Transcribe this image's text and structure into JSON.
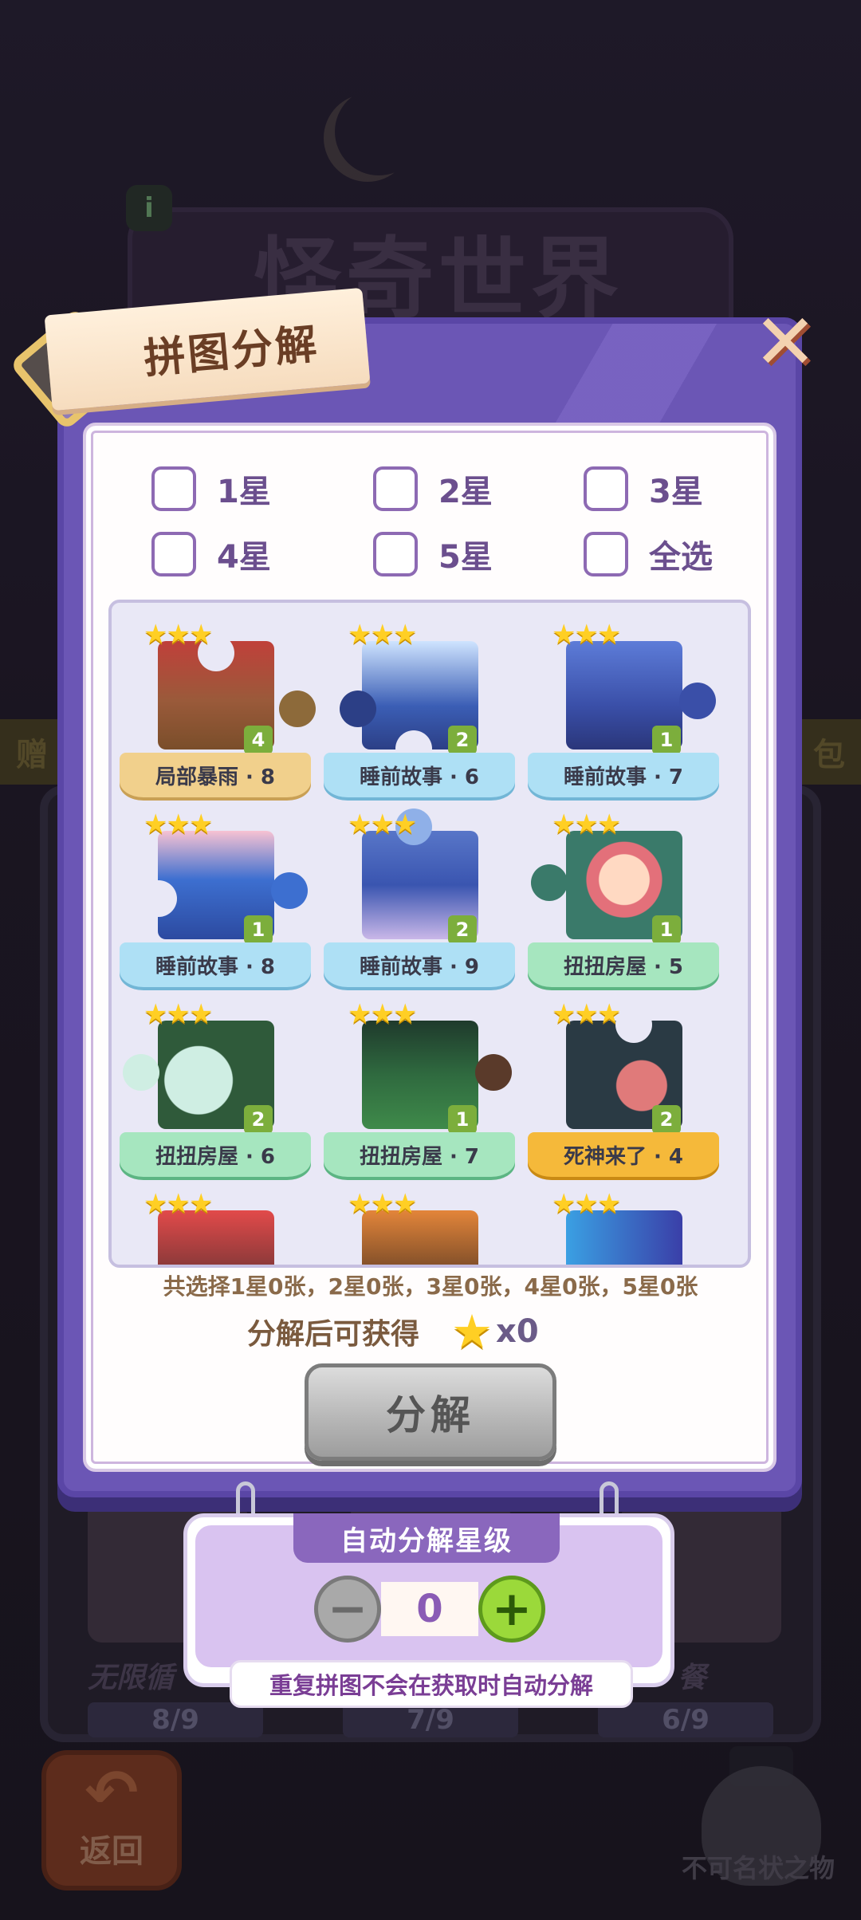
{
  "background": {
    "banner_title": "怪奇世界",
    "side_left": "赠",
    "side_right": "包",
    "card_labels": [
      "无限循",
      "",
      "餐"
    ],
    "progress": [
      "8/9",
      "7/9",
      "6/9"
    ],
    "back_label": "返回",
    "brand": "不可名状之物"
  },
  "dialog": {
    "title": "拼图分解",
    "close_icon": "close-icon"
  },
  "filters": [
    {
      "label": "1星"
    },
    {
      "label": "2星"
    },
    {
      "label": "3星"
    },
    {
      "label": "4星"
    },
    {
      "label": "5星"
    },
    {
      "label": "全选"
    }
  ],
  "puzzles": [
    {
      "name": "局部暴雨 · 8",
      "count": "4",
      "stars": "★★★"
    },
    {
      "name": "睡前故事 · 6",
      "count": "2",
      "stars": "★★★"
    },
    {
      "name": "睡前故事 · 7",
      "count": "1",
      "stars": "★★★"
    },
    {
      "name": "睡前故事 · 8",
      "count": "1",
      "stars": "★★★"
    },
    {
      "name": "睡前故事 · 9",
      "count": "2",
      "stars": "★★★"
    },
    {
      "name": "扭扭房屋 · 5",
      "count": "1",
      "stars": "★★★"
    },
    {
      "name": "扭扭房屋 · 6",
      "count": "2",
      "stars": "★★★"
    },
    {
      "name": "扭扭房屋 · 7",
      "count": "1",
      "stars": "★★★"
    },
    {
      "name": "死神来了 · 4",
      "count": "2",
      "stars": "★★★"
    },
    {
      "name": "",
      "count": "",
      "stars": "★★★"
    },
    {
      "name": "",
      "count": "",
      "stars": "★★★"
    },
    {
      "name": "",
      "count": "",
      "stars": "★★★"
    }
  ],
  "summary": "共选择1星0张，2星0张，3星0张，4星0张，5星0张",
  "reward": {
    "label": "分解后可获得",
    "amount": "x0"
  },
  "decompose_button": "分解",
  "auto": {
    "title": "自动分解星级",
    "minus": "−",
    "plus": "+",
    "value": "0",
    "note": "重复拼图不会在获取时自动分解"
  }
}
